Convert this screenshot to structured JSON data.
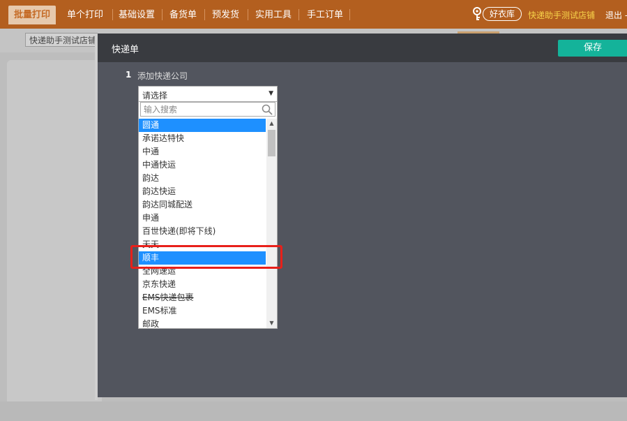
{
  "nav": {
    "tabs": [
      "批量打印",
      "单个打印",
      "基础设置",
      "备货单",
      "预发货",
      "实用工具",
      "手工订单"
    ],
    "brand": "好衣库",
    "shop_name": "快递助手测试店铺",
    "logout": "退出 -",
    "active_color": "#c56a25",
    "bar_color": "#b35f1f"
  },
  "toolbar": {
    "shop_select": "快递助手测试店铺"
  },
  "modal": {
    "title": "快递单",
    "save_label": "保存",
    "save_color": "#14b39a",
    "step_number": "1",
    "step_label": "添加快递公司",
    "select_value": "请选择",
    "search_placeholder": "输入搜索",
    "options": [
      "圆通",
      "承诺达特快",
      "中通",
      "中通快运",
      "韵达",
      "韵达快运",
      "韵达同城配送",
      "申通",
      "百世快递(即将下线)",
      "天天",
      "顺丰",
      "全网速运",
      "京东快递",
      "EMS快递包裹",
      "EMS标准",
      "邮政"
    ],
    "highlighted_options": [
      "圆通",
      "顺丰"
    ],
    "highlight_color": "#1e90ff",
    "annotation_color": "#e8201a"
  }
}
